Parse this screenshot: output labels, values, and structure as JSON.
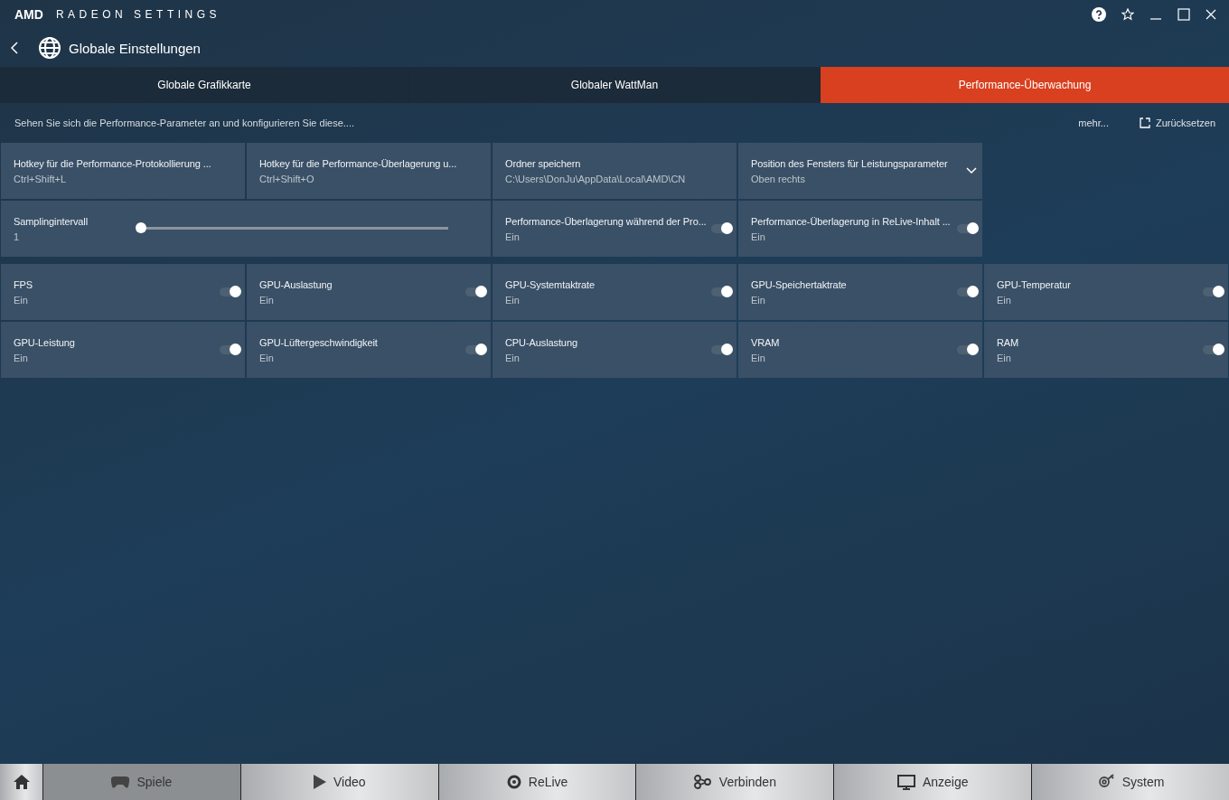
{
  "app": {
    "brand": "AMD",
    "title": "RADEON SETTINGS"
  },
  "header": {
    "title": "Globale Einstellungen"
  },
  "tabs": [
    {
      "label": "Globale Grafikkarte",
      "selected": false
    },
    {
      "label": "Globaler WattMan",
      "selected": false
    },
    {
      "label": "Performance-Überwachung",
      "selected": true
    }
  ],
  "description": "Sehen Sie sich die Performance-Parameter an und konfigurieren Sie diese....",
  "more_link": "mehr...",
  "reset_button": "Zurücksetzen",
  "settings_rows": [
    [
      {
        "kind": "text",
        "label": "Hotkey für die Performance-Protokollierung ...",
        "value": "Ctrl+Shift+L"
      },
      {
        "kind": "text",
        "label": "Hotkey für die Performance-Überlagerung u...",
        "value": "Ctrl+Shift+O"
      },
      {
        "kind": "text",
        "label": "Ordner speichern",
        "value": "C:\\Users\\DonJu\\AppData\\Local\\AMD\\CN"
      },
      {
        "kind": "dropdown",
        "label": "Position des Fensters für Leistungsparameter",
        "value": "Oben rechts"
      }
    ],
    [
      {
        "kind": "slider",
        "label": "Samplingintervall",
        "value": "1",
        "level": 0
      },
      {
        "kind": "toggle",
        "label": "Performance-Überlagerung während der Pro...",
        "value": "Ein",
        "on": true
      },
      {
        "kind": "toggle",
        "label": "Performance-Überlagerung in ReLive-Inhalt ...",
        "value": "Ein",
        "on": true
      }
    ],
    [
      {
        "kind": "toggle",
        "label": "FPS",
        "value": "Ein",
        "on": true
      },
      {
        "kind": "toggle",
        "label": "GPU-Auslastung",
        "value": "Ein",
        "on": true
      },
      {
        "kind": "toggle",
        "label": "GPU-Systemtaktrate",
        "value": "Ein",
        "on": true
      },
      {
        "kind": "toggle",
        "label": "GPU-Speichertaktrate",
        "value": "Ein",
        "on": true
      },
      {
        "kind": "toggle",
        "label": "GPU-Temperatur",
        "value": "Ein",
        "on": true
      }
    ],
    [
      {
        "kind": "toggle",
        "label": "GPU-Leistung",
        "value": "Ein",
        "on": true
      },
      {
        "kind": "toggle",
        "label": "GPU-Lüftergeschwindigkeit",
        "value": "Ein",
        "on": true
      },
      {
        "kind": "toggle",
        "label": "CPU-Auslastung",
        "value": "Ein",
        "on": true
      },
      {
        "kind": "toggle",
        "label": "VRAM",
        "value": "Ein",
        "on": true
      },
      {
        "kind": "toggle",
        "label": "RAM",
        "value": "Ein",
        "on": true
      }
    ]
  ],
  "bottom_nav": [
    {
      "kind": "home",
      "selected": false
    },
    {
      "kind": "games",
      "label": "Spiele",
      "selected": true
    },
    {
      "kind": "video",
      "label": "Video",
      "selected": false
    },
    {
      "kind": "relive",
      "label": "ReLive",
      "selected": false
    },
    {
      "kind": "connect",
      "label": "Verbinden",
      "selected": false
    },
    {
      "kind": "display",
      "label": "Anzeige",
      "selected": false
    },
    {
      "kind": "system",
      "label": "System",
      "selected": false
    }
  ]
}
